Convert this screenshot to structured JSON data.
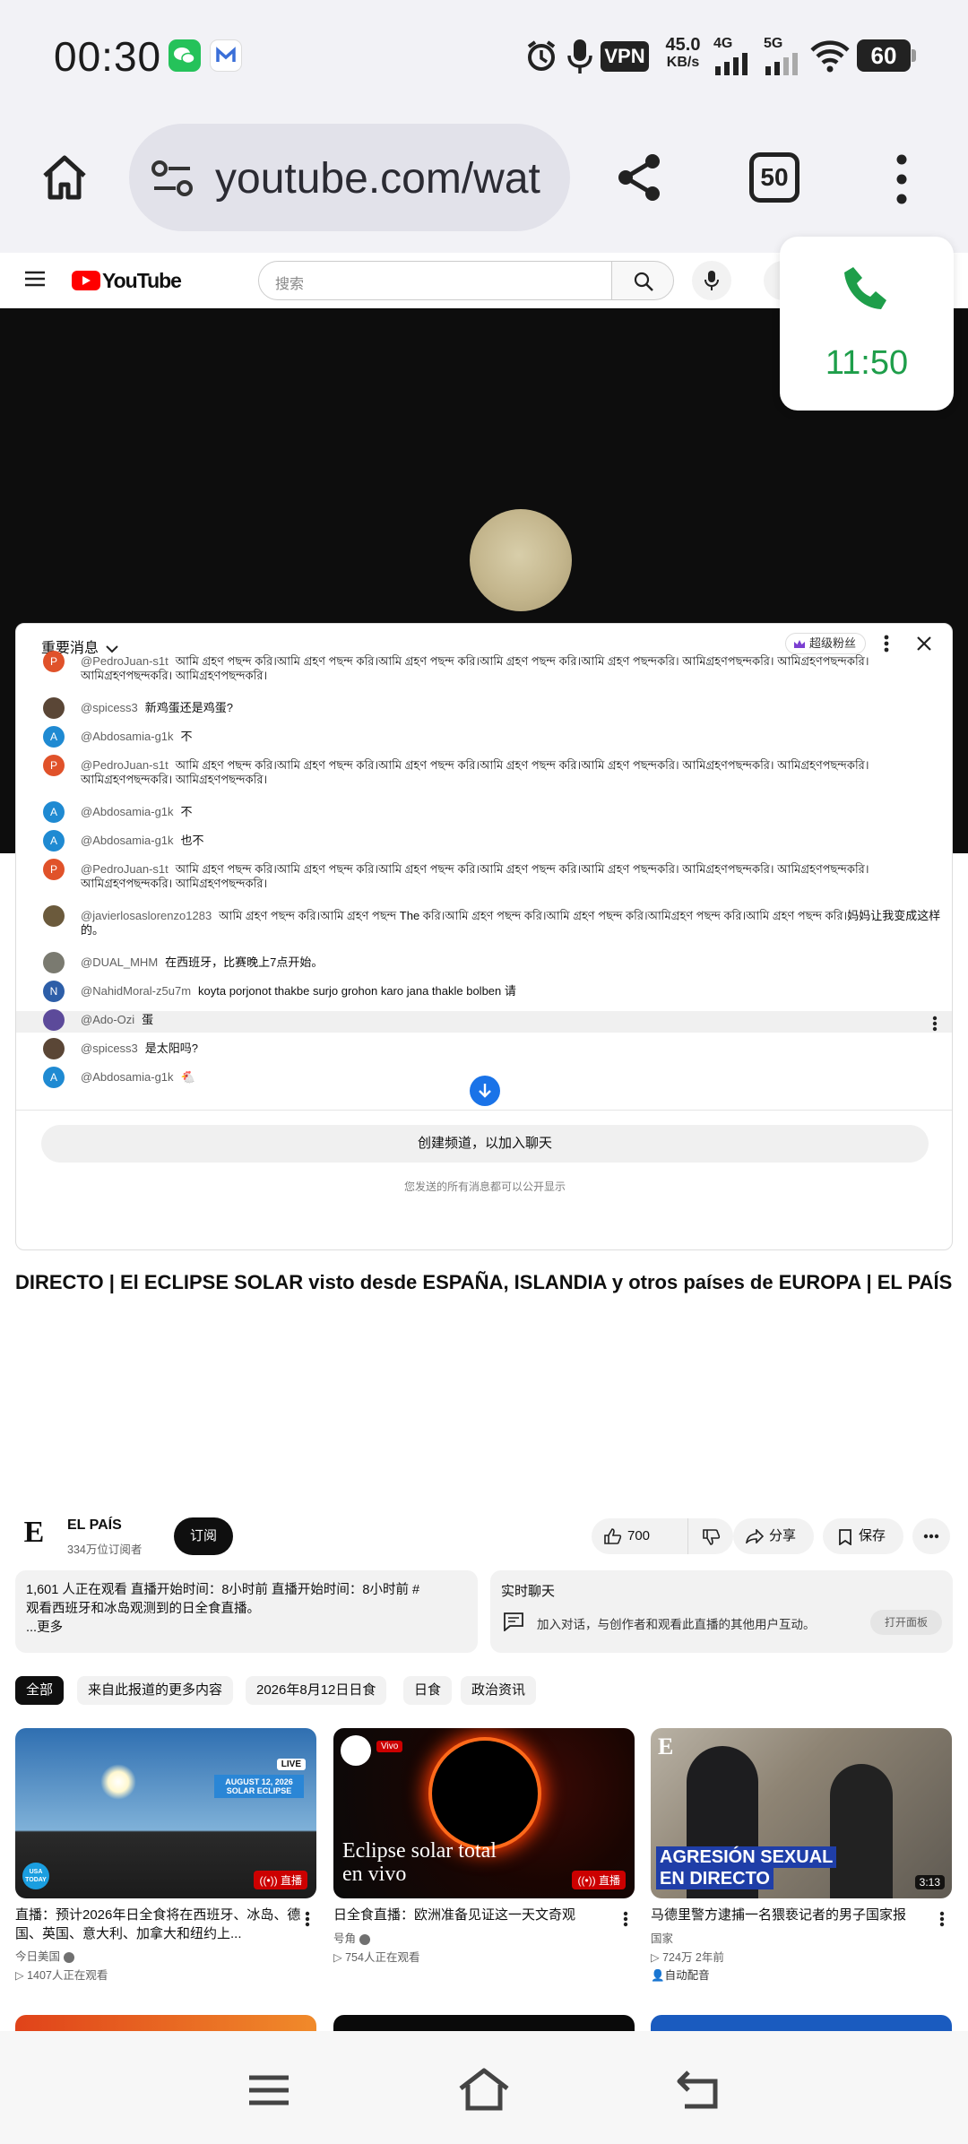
{
  "status_bar": {
    "time": "00:30",
    "speed_value": "45.0",
    "speed_unit": "KB/s",
    "net1": "4G",
    "net2": "5G",
    "battery": "60",
    "vpn": "VPN"
  },
  "browser": {
    "url": "youtube.com/wat",
    "tabs_count": "50"
  },
  "youtube": {
    "logo": "YouTube",
    "search_placeholder": "搜索"
  },
  "call_overlay": {
    "time": "11:50",
    "color": "#1e9e4a"
  },
  "chat": {
    "title": "重要消息",
    "super_badge": "超级粉丝",
    "messages": [
      {
        "initial": "P",
        "color": "#e0522a",
        "author": "@PedroJuan-s1t",
        "text": "আমি গ্রহণ পছন্দ করি।আমি গ্রহণ পছন্দ করি।আমি গ্রহণ পছন্দ করি।আমি গ্রহণ পছন্দ করি।আমি গ্রহণ পছন্দকরি। আমিগ্রহণপছন্দকরি। আমিগ্রহণপছন্দকরি। আমিগ্রহণপছন্দকরি। আমিগ্রহণপছন্দকরি।"
      },
      {
        "initial": "",
        "color": "#5a4636",
        "author": "@spicess3",
        "text": "新鸡蛋还是鸡蛋?"
      },
      {
        "initial": "A",
        "color": "#1f8ad2",
        "author": "@Abdosamia-g1k",
        "text": "不"
      },
      {
        "initial": "P",
        "color": "#e0522a",
        "author": "@PedroJuan-s1t",
        "text": "আমি গ্রহণ পছন্দ করি।আমি গ্রহণ পছন্দ করি।আমি গ্রহণ পছন্দ করি।আমি গ্রহণ পছন্দ করি।আমি গ্রহণ পছন্দকরি। আমিগ্রহণপছন্দকরি। আমিগ্রহণপছন্দকরি। আমিগ্রহণপছন্দকরি। আমিগ্রহণপছন্দকরি।"
      },
      {
        "initial": "A",
        "color": "#1f8ad2",
        "author": "@Abdosamia-g1k",
        "text": "不"
      },
      {
        "initial": "A",
        "color": "#1f8ad2",
        "author": "@Abdosamia-g1k",
        "text": "也不"
      },
      {
        "initial": "P",
        "color": "#e0522a",
        "author": "@PedroJuan-s1t",
        "text": "আমি গ্রহণ পছন্দ করি।আমি গ্রহণ পছন্দ করি।আমি গ্রহণ পছন্দ করি।আমি গ্রহণ পছন্দ করি।আমি গ্রহণ পছন্দকরি। আমিগ্রহণপছন্দকরি। আমিগ্রহণপছন্দকরি। আমিগ্রহণপছন্দকরি। আমিগ্রহণপছন্দকরি।"
      },
      {
        "initial": "",
        "color": "#6b5a3c",
        "author": "@javierlosaslorenzo1283",
        "text": "আমি গ্রহণ পছন্দ করি।আমি গ্রহণ পছন্দ The করি।আমি গ্রহণ পছন্দ করি।আমি গ্রহণ পছন্দ করি।আমিগ্রহণ পছন্দ করি।আমি গ্রহণ পছন্দ করি।妈妈让我变成这样的。"
      },
      {
        "initial": "",
        "color": "#7a7a70",
        "author": "@DUAL_MHM",
        "text": "在西班牙，比赛晚上7点开始。"
      },
      {
        "initial": "N",
        "color": "#2d5ea8",
        "author": "@NahidMoral-z5u7m",
        "text": "koyta porjonot thakbe surjo grohon karo jana thakle bolben 请"
      },
      {
        "initial": "",
        "color": "#5c4a9a",
        "author": "@Ado-Ozi",
        "text": "蛋"
      },
      {
        "initial": "",
        "color": "#5a4636",
        "author": "@spicess3",
        "text": "是太阳吗?"
      },
      {
        "initial": "A",
        "color": "#1f8ad2",
        "author": "@Abdosamia-g1k",
        "text": "🐔"
      }
    ],
    "create_channel": "创建频道，以加入聊天",
    "note": "您发送的所有消息都可以公开显示"
  },
  "video": {
    "title": "DIRECTO | El ECLIPSE SOLAR visto desde ESPAÑA, ISLANDIA y otros países de EUROPA | EL PAÍS",
    "channel": "EL PAÍS",
    "channel_logo": "E",
    "subscribers": "334万位订阅者",
    "subscribe": "订阅",
    "likes": "700",
    "share": "分享",
    "save": "保存"
  },
  "description": {
    "line1": "1,601 人正在观看  直播开始时间：8小时前  直播开始时间：8小时前 #",
    "line2": "观看西班牙和冰岛观测到的日全食直播。",
    "more": "...更多"
  },
  "live_chat_card": {
    "title": "实时聊天",
    "text": "加入对话，与创作者和观看此直播的其他用户互动。",
    "open": "打开面板"
  },
  "chips": [
    "全部",
    "来自此报道的更多内容",
    "2026年8月12日日食",
    "日食",
    "政治资讯"
  ],
  "cards": [
    {
      "title": "直播：预计2026年日全食将在西班牙、冰岛、德国、英国、意大利、加拿大和纽约上...",
      "channel": "今日美国",
      "meta": "1407人正在观看",
      "badge": "直播",
      "thumb_text1": "AUGUST 12, 2026",
      "thumb_text2": "SOLAR ECLIPSE",
      "thumb_live": "LIVE",
      "thumb_logo": "USA TODAY"
    },
    {
      "title": "日全食直播：欧洲准备见证这一天文奇观",
      "channel": "号角",
      "meta": "754人正在观看",
      "badge": "直播",
      "thumb_text1": "Eclipse solar total",
      "thumb_text2": "en vivo",
      "thumb_live": "Vivo"
    },
    {
      "title": "马德里警方逮捕一名猥亵记者的男子国家报",
      "channel": "国家",
      "meta": "724万  2年前",
      "extra": "自动配音",
      "duration": "3:13",
      "thumb_text1": "AGRESIÓN SEXUAL",
      "thumb_text2": "EN DIRECTO",
      "thumb_logo": "E"
    }
  ]
}
